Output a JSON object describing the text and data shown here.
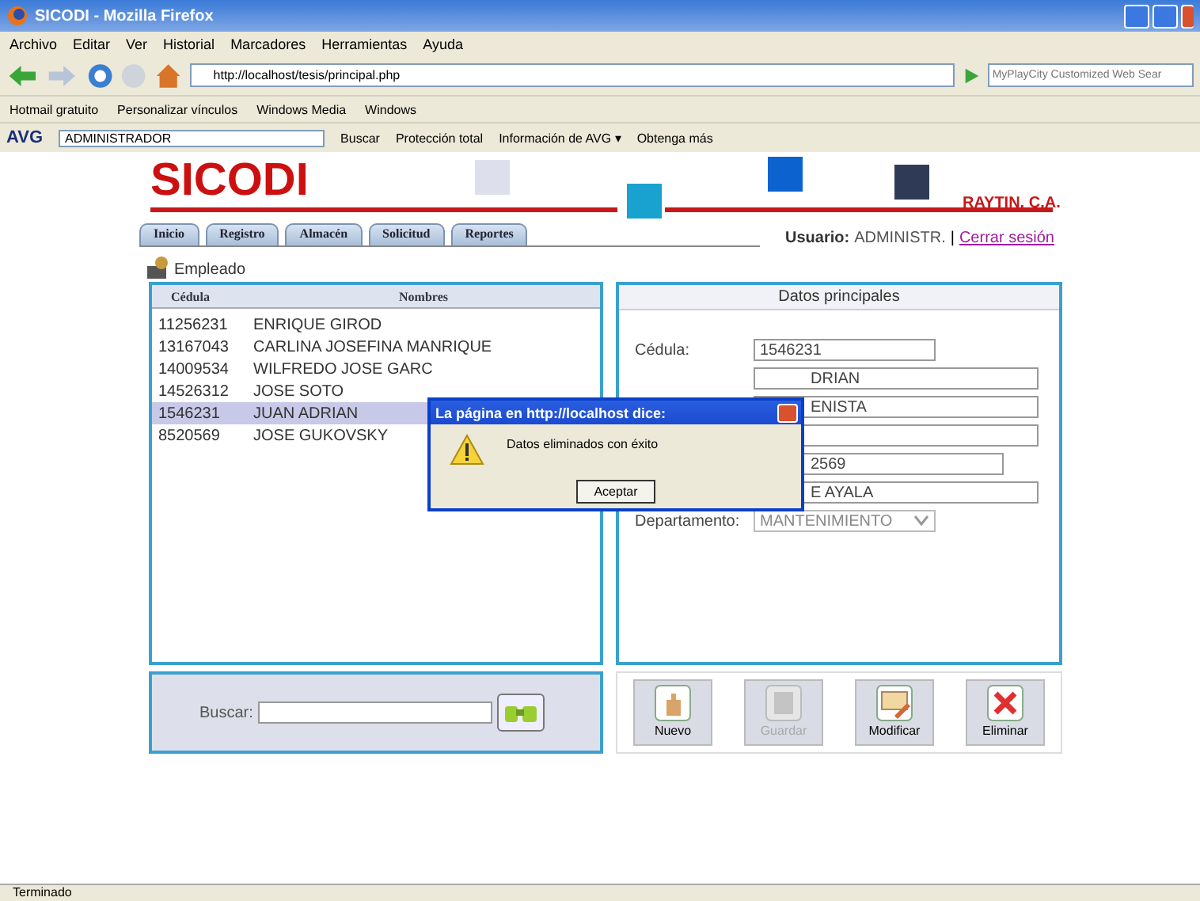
{
  "window": {
    "title": "SICODI - Mozilla Firefox"
  },
  "menu": [
    "Archivo",
    "Editar",
    "Ver",
    "Historial",
    "Marcadores",
    "Herramientas",
    "Ayuda"
  ],
  "address": {
    "value": "http://localhost/tesis/principal.php"
  },
  "search": {
    "placeholder": "MyPlayCity Customized Web Sear"
  },
  "bookmarks": [
    "Hotmail gratuito",
    "Personalizar vínculos",
    "Windows Media",
    "Windows"
  ],
  "avg_toolbar": {
    "logo": "AVG",
    "user": "ADMINISTRADOR",
    "items": [
      "Buscar",
      "Protección total",
      "Información de AVG ▾",
      "Obtenga más"
    ]
  },
  "page": {
    "logo": "SICODI",
    "company": "RAYTIN, C.A.",
    "tabs": [
      {
        "label": "Inicio",
        "selected": false
      },
      {
        "label": "Registro",
        "selected": false
      },
      {
        "label": "Almacén",
        "selected": false
      },
      {
        "label": "Solicitud",
        "selected": false
      },
      {
        "label": "Reportes",
        "selected": false
      }
    ],
    "user_label": "Usuario:",
    "user": "ADMINISTR.",
    "separator": "|",
    "logout": "Cerrar sesión",
    "section": "Empleado",
    "table": {
      "columns": [
        "Cédula",
        "Nombres"
      ],
      "rows": [
        {
          "cells": [
            "11256231",
            "ENRIQUE GIROD"
          ],
          "selected": false
        },
        {
          "cells": [
            "13167043",
            "CARLINA JOSEFINA MANRIQUE"
          ],
          "selected": false
        },
        {
          "cells": [
            "14009534",
            "WILFREDO JOSE GARC"
          ],
          "selected": false
        },
        {
          "cells": [
            "14526312",
            "JOSE SOTO"
          ],
          "selected": false
        },
        {
          "cells": [
            "1546231",
            "JUAN ADRIAN"
          ],
          "selected": true
        },
        {
          "cells": [
            "8520569",
            "JOSE GUKOVSKY"
          ],
          "selected": false
        }
      ]
    },
    "form": {
      "title": "Datos principales",
      "fields": [
        {
          "kind": "text",
          "label": "Cédula:",
          "value": "1546231"
        },
        {
          "kind": "text",
          "value": "DRIAN"
        },
        {
          "kind": "text",
          "value": "ENISTA"
        },
        {
          "kind": "text"
        },
        {
          "kind": "text",
          "value": "2569"
        },
        {
          "kind": "text",
          "value": "E AYALA"
        },
        {
          "kind": "select",
          "label": "Departamento:",
          "value": "MANTENIMIENTO"
        }
      ]
    },
    "search_label": "Buscar:",
    "actions": [
      {
        "kind": "new",
        "label": "Nuevo",
        "disabled": false
      },
      {
        "kind": "save",
        "label": "Guardar",
        "disabled": true
      },
      {
        "kind": "edit",
        "label": "Modificar",
        "disabled": false
      },
      {
        "kind": "delete",
        "label": "Eliminar",
        "disabled": false
      }
    ]
  },
  "dialog": {
    "title": "La página en http://localhost dice:",
    "message": "Datos eliminados con éxito",
    "button": "Aceptar"
  },
  "status_bar": "Terminado"
}
